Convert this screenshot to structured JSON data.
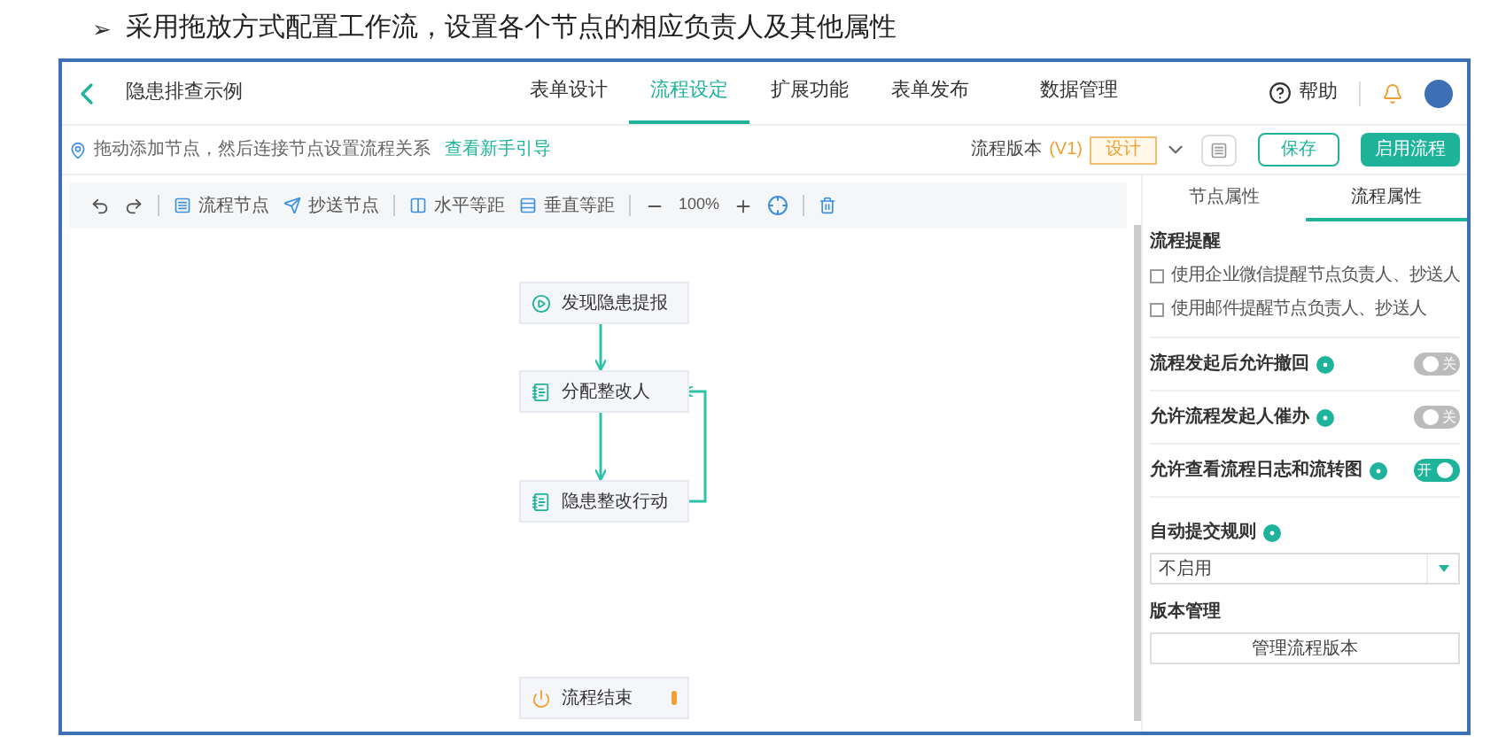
{
  "heading": {
    "marker": "➢",
    "text": "采用拖放方式配置工作流，设置各个节点的相应负责人及其他属性"
  },
  "app": {
    "title": "隐患排查示例",
    "help": "帮助",
    "tabs": [
      {
        "label": "表单设计",
        "selected": false
      },
      {
        "label": "流程设定",
        "selected": true
      },
      {
        "label": "扩展功能",
        "selected": false
      },
      {
        "label": "表单发布",
        "selected": false
      },
      {
        "label": "数据管理",
        "selected": false
      }
    ]
  },
  "hint": {
    "text": "拖动添加节点，然后连接节点设置流程关系",
    "link": "查看新手引导"
  },
  "version": {
    "label": "流程版本",
    "number": "(V1)",
    "status": "设计"
  },
  "buttons": {
    "save": "保存",
    "enable": "启用流程"
  },
  "toolbar": {
    "node_buttons": [
      "流程节点",
      "抄送节点"
    ],
    "align_buttons": [
      "水平等距",
      "垂直等距"
    ],
    "zoom": "100%"
  },
  "nodes": [
    {
      "label": "发现隐患提报",
      "kind": "start"
    },
    {
      "label": "分配整改人",
      "kind": "task"
    },
    {
      "label": "隐患整改行动",
      "kind": "task"
    },
    {
      "label": "流程结束",
      "kind": "end"
    }
  ],
  "panel": {
    "tabs": [
      {
        "label": "节点属性",
        "selected": false
      },
      {
        "label": "流程属性",
        "selected": true
      }
    ],
    "reminder_title": "流程提醒",
    "checkboxes": [
      {
        "label": "使用企业微信提醒节点负责人、抄送人",
        "checked": false
      },
      {
        "label": "使用邮件提醒节点负责人、抄送人",
        "checked": false
      }
    ],
    "toggles": [
      {
        "label": "流程发起后允许撤回",
        "on": false,
        "state_text": "关"
      },
      {
        "label": "允许流程发起人催办",
        "on": false,
        "state_text": "关"
      },
      {
        "label": "允许查看流程日志和流转图",
        "on": true,
        "state_text": "开"
      }
    ],
    "rule": {
      "label": "自动提交规则",
      "value": "不启用"
    },
    "version_management": {
      "label": "版本管理",
      "button": "管理流程版本"
    }
  }
}
